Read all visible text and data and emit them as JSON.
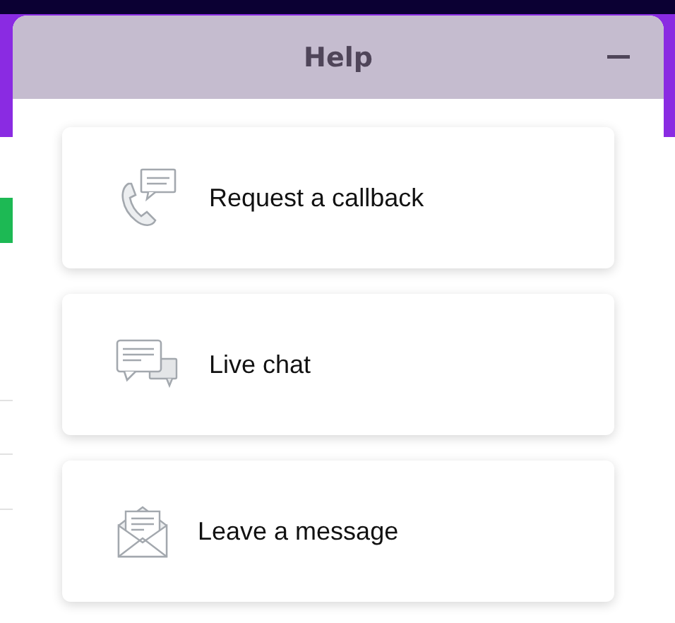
{
  "panel": {
    "title": "Help"
  },
  "options": [
    {
      "kind": "callback",
      "label": "Request a callback"
    },
    {
      "kind": "chat",
      "label": "Live chat"
    },
    {
      "kind": "message",
      "label": "Leave a message"
    }
  ]
}
